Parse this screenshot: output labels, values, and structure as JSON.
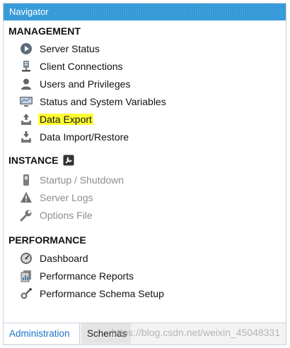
{
  "navigator": {
    "title": "Navigator"
  },
  "management": {
    "header": "MANAGEMENT",
    "items": [
      {
        "label": "Server Status",
        "icon": "play-circle-icon"
      },
      {
        "label": "Client Connections",
        "icon": "client-connections-icon"
      },
      {
        "label": "Users and Privileges",
        "icon": "user-icon"
      },
      {
        "label": "Status and System Variables",
        "icon": "monitor-icon"
      },
      {
        "label": "Data Export",
        "icon": "upload-tray-icon",
        "highlighted": true
      },
      {
        "label": "Data Import/Restore",
        "icon": "download-tray-icon"
      }
    ]
  },
  "instance": {
    "header": "INSTANCE",
    "icon": "wrench-badge-icon",
    "items": [
      {
        "label": "Startup / Shutdown",
        "icon": "power-switch-icon",
        "disabled": true
      },
      {
        "label": "Server Logs",
        "icon": "warning-icon",
        "disabled": true
      },
      {
        "label": "Options File",
        "icon": "wrench-icon",
        "disabled": true
      }
    ]
  },
  "performance": {
    "header": "PERFORMANCE",
    "items": [
      {
        "label": "Dashboard",
        "icon": "gauge-icon"
      },
      {
        "label": "Performance Reports",
        "icon": "reports-icon"
      },
      {
        "label": "Performance Schema Setup",
        "icon": "schema-setup-icon"
      }
    ]
  },
  "tabs": {
    "administration": "Administration",
    "schemas": "Schemas"
  },
  "watermark": "https://blog.csdn.net/weixin_45048331",
  "colors": {
    "titlebar": "#2b95d6",
    "highlight": "#ffff33",
    "active_tab_text": "#1a73c9"
  }
}
